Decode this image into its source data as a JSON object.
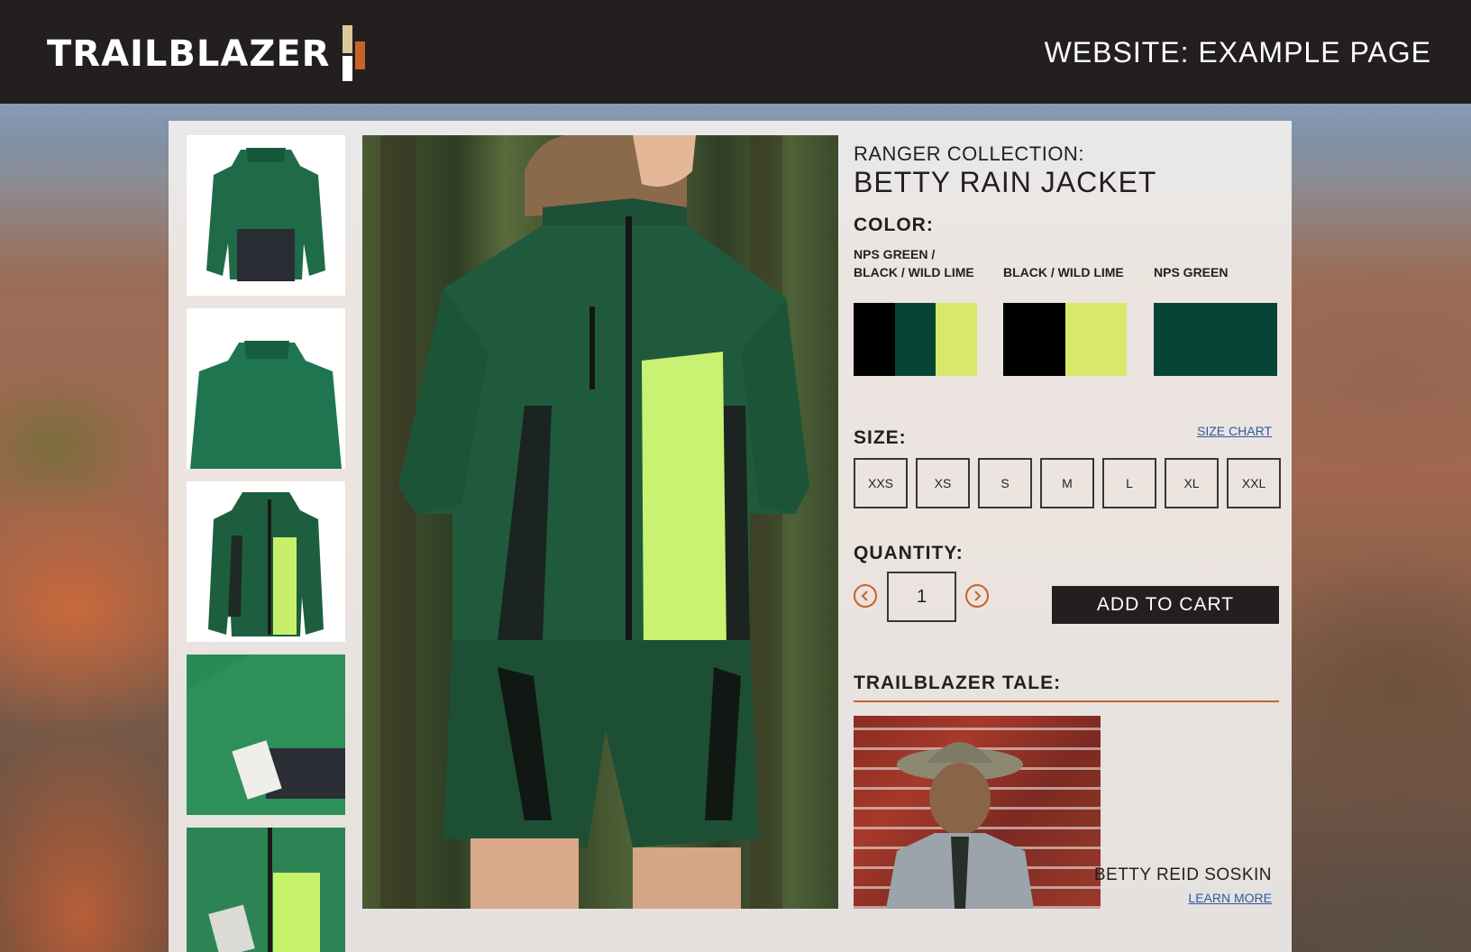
{
  "header": {
    "brand": "TRAILBLAZER",
    "page_label": "WEBSITE: EXAMPLE PAGE"
  },
  "product": {
    "collection": "RANGER COLLECTION:",
    "name": "BETTY RAIN JACKET"
  },
  "color": {
    "label": "COLOR:",
    "swatches": [
      {
        "label": "NPS GREEN /\nBLACK / WILD LIME",
        "colors": [
          "#000000",
          "#064536",
          "#d9e86a"
        ]
      },
      {
        "label": "BLACK / WILD LIME",
        "colors": [
          "#000000",
          "#d9e86a"
        ]
      },
      {
        "label": "NPS GREEN",
        "colors": [
          "#064536"
        ]
      }
    ]
  },
  "size": {
    "label": "SIZE:",
    "chart_link": "SIZE CHART",
    "options": [
      "XXS",
      "XS",
      "S",
      "M",
      "L",
      "XL",
      "XXL"
    ]
  },
  "quantity": {
    "label": "QUANTITY:",
    "value": "1",
    "decrement_icon": "chevron-left-icon",
    "increment_icon": "chevron-right-icon"
  },
  "cart": {
    "add_label": "ADD TO CART"
  },
  "tale": {
    "label": "TRAILBLAZER TALE:",
    "name": "BETTY REID SOSKIN",
    "link": "LEARN MORE"
  },
  "colors": {
    "dark": "#231f20",
    "accent": "#c8622c",
    "nps_green": "#064536",
    "wild_lime": "#d9e86a",
    "link": "#2c5aa0"
  }
}
